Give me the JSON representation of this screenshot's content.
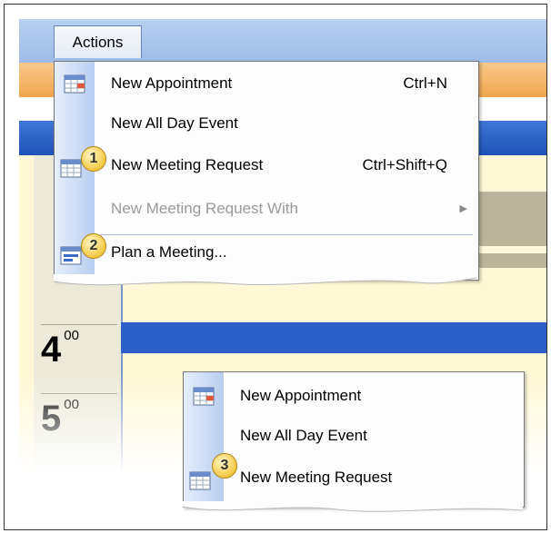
{
  "menubar": {
    "actions_label": "Actions",
    "actions_hotkey_index": 0
  },
  "menu1": {
    "items": [
      {
        "label": "New Appointment",
        "shortcut": "Ctrl+N",
        "icon": "appointment-calendar-icon",
        "enabled": true
      },
      {
        "label": "New All Day Event",
        "shortcut": "",
        "icon": "",
        "enabled": true
      },
      {
        "label": "New Meeting Request",
        "shortcut": "Ctrl+Shift+Q",
        "icon": "meeting-request-icon",
        "enabled": true
      },
      {
        "label": "New Meeting Request With",
        "shortcut": "",
        "icon": "",
        "enabled": false,
        "submenu": true
      },
      {
        "label": "Plan a Meeting...",
        "shortcut": "",
        "icon": "plan-meeting-icon",
        "enabled": true
      }
    ]
  },
  "menu2": {
    "items": [
      {
        "label": "New Appointment",
        "icon": "appointment-calendar-icon"
      },
      {
        "label": "New All Day Event",
        "icon": ""
      },
      {
        "label": "New Meeting Request",
        "icon": "meeting-request-icon"
      }
    ]
  },
  "calendar": {
    "hour_4": "4",
    "hour_5": "5",
    "minutes": "00"
  },
  "callouts": [
    "1",
    "2",
    "3"
  ],
  "colors": {
    "menu_gutter": "#b9cdf0",
    "calendar_header": "#2a5fc8",
    "calendar_body": "#fff8d6",
    "callout": "#f5c842"
  }
}
